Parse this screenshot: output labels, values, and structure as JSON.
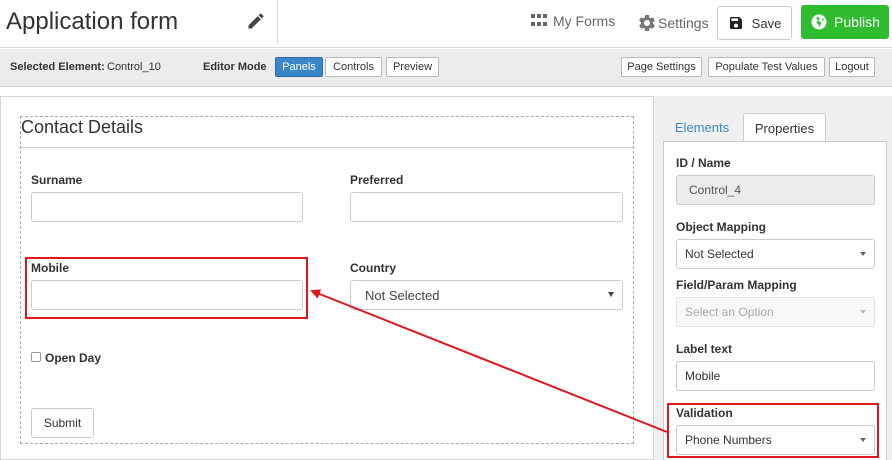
{
  "header": {
    "title": "Application form",
    "my_forms_label": "My Forms",
    "settings_label": "Settings",
    "save_label": "Save",
    "publish_label": "Publish",
    "publish_color": "#2fbd2f"
  },
  "toolbar": {
    "selected_element_label": "Selected Element:",
    "selected_element_value": "Control_10",
    "editor_mode_label": "Editor Mode",
    "mode_buttons": [
      "Panels",
      "Controls",
      "Preview"
    ],
    "active_mode": "Panels",
    "page_settings_label": "Page Settings",
    "populate_label": "Populate Test Values",
    "logout_label": "Logout",
    "accent_color": "#3a87c7"
  },
  "form": {
    "panel_title": "Contact Details",
    "fields": {
      "surname_label": "Surname",
      "preferred_label": "Preferred",
      "mobile_label": "Mobile",
      "country_label": "Country",
      "country_value": "Not Selected",
      "open_day_label": "Open Day"
    },
    "submit_label": "Submit"
  },
  "sidebar": {
    "tabs": [
      "Elements",
      "Properties"
    ],
    "active_tab": "Properties",
    "properties": {
      "id_label": "ID / Name",
      "id_value": "Control_4",
      "object_mapping_label": "Object Mapping",
      "object_mapping_value": "Not Selected",
      "field_mapping_label": "Field/Param Mapping",
      "field_mapping_placeholder": "Select an Option",
      "label_text_label": "Label text",
      "label_text_value": "Mobile",
      "validation_label": "Validation",
      "validation_value": "Phone Numbers"
    }
  },
  "annotation": {
    "highlight_color": "#e0171f"
  }
}
